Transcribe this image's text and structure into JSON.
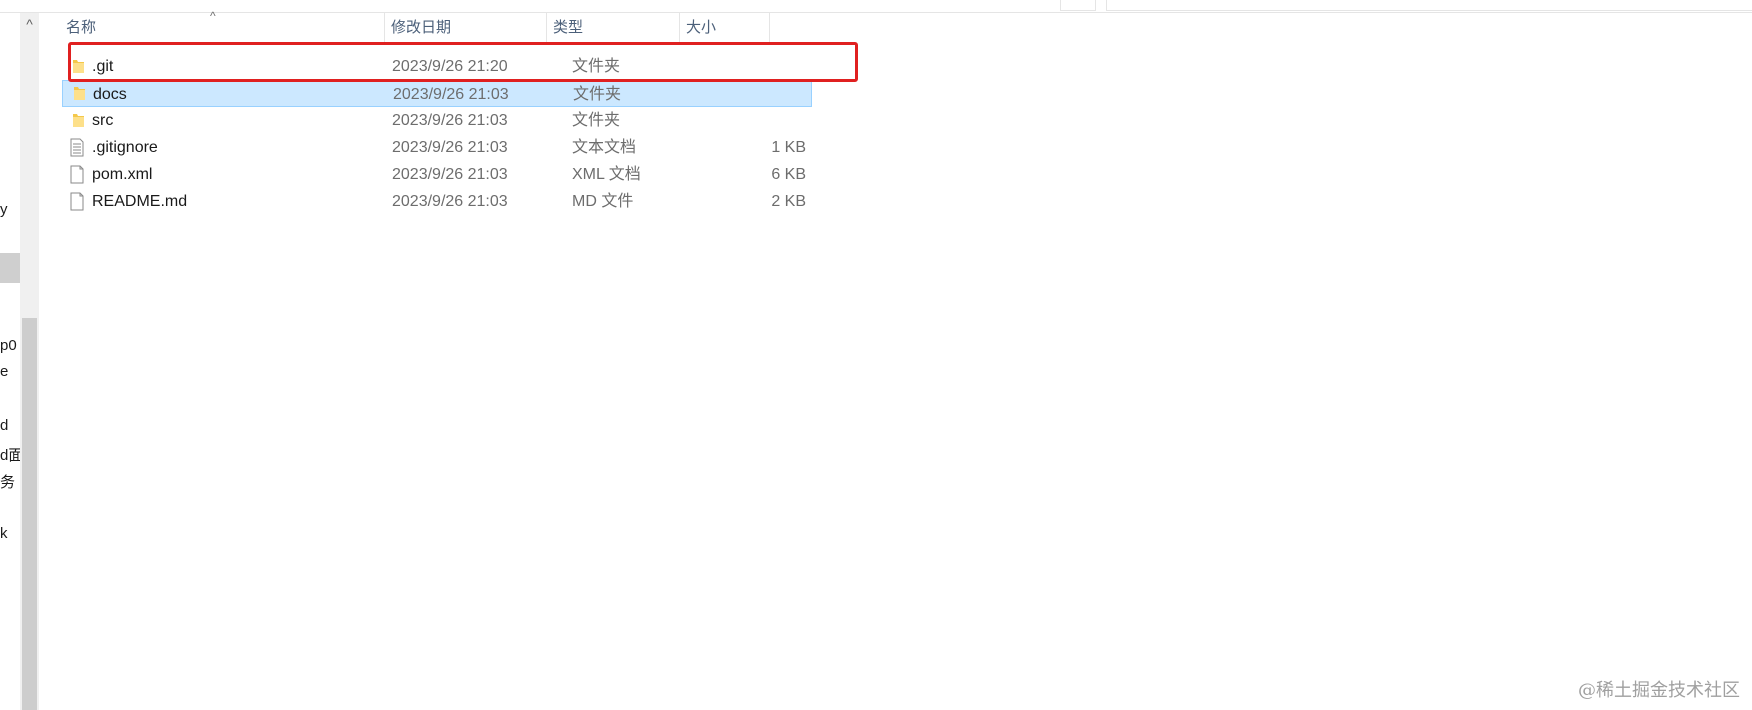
{
  "nav": {
    "items": [
      {
        "label": "y"
      },
      {
        "label": ""
      },
      {
        "label": "p0"
      },
      {
        "label": "e"
      },
      {
        "label": "d"
      },
      {
        "label": "d面"
      },
      {
        "label": "务"
      },
      {
        "label": "k"
      }
    ],
    "scroll_up_glyph": "^"
  },
  "list": {
    "sort_glyph": "^",
    "columns": {
      "name": "名称",
      "date": "修改日期",
      "type": "类型",
      "size": "大小"
    },
    "rows": [
      {
        "name": ".git",
        "date": "2023/9/26 21:20",
        "type": "文件夹",
        "size": "",
        "icon": "folder-icon"
      },
      {
        "name": "docs",
        "date": "2023/9/26 21:03",
        "type": "文件夹",
        "size": "",
        "icon": "folder-icon"
      },
      {
        "name": "src",
        "date": "2023/9/26 21:03",
        "type": "文件夹",
        "size": "",
        "icon": "folder-icon"
      },
      {
        "name": ".gitignore",
        "date": "2023/9/26 21:03",
        "type": "文本文档",
        "size": "1 KB",
        "icon": "text-file-icon"
      },
      {
        "name": "pom.xml",
        "date": "2023/9/26 21:03",
        "type": "XML 文档",
        "size": "6 KB",
        "icon": "file-icon"
      },
      {
        "name": "README.md",
        "date": "2023/9/26 21:03",
        "type": "MD 文件",
        "size": "2 KB",
        "icon": "file-icon"
      }
    ],
    "selected_row": "docs"
  },
  "watermark": "@稀土掘金技术社区",
  "colors": {
    "selection_bg": "#cce8ff",
    "selection_border": "#99d1ff",
    "highlight": "#e02020",
    "folder": "#f4c84b"
  }
}
